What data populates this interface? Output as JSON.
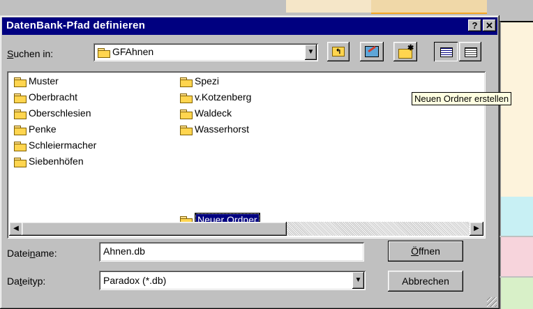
{
  "dialog": {
    "title": "DatenBank-Pfad definieren",
    "help_button": "?",
    "close_button": "✕"
  },
  "lookin": {
    "label_pre": "",
    "label_key": "S",
    "label_post": "uchen in:",
    "value": "GFAhnen"
  },
  "toolbar": {
    "icons": [
      "up-folder-icon",
      "desktop-icon",
      "new-folder-icon",
      "list-view-icon",
      "details-view-icon"
    ]
  },
  "folders_col1": [
    "Muster",
    "Oberbracht",
    "Oberschlesien",
    "Penke",
    "Schleiermacher",
    "Siebenhöfen"
  ],
  "folders_col2": [
    "Spezi",
    "v.Kotzenberg",
    "Waldeck",
    "Wasserhorst"
  ],
  "editing_folder": "Neuer Ordner",
  "tooltip": "Neuen Ordner erstellen",
  "filename": {
    "label_pre": "Datei",
    "label_key": "n",
    "label_post": "ame:",
    "value": "Ahnen.db"
  },
  "filetype": {
    "label_pre": "Da",
    "label_key": "t",
    "label_post": "eityp:",
    "value": "Paradox (*.db)"
  },
  "buttons": {
    "open_pre": "",
    "open_key": "Ö",
    "open_post": "ffnen",
    "cancel": "Abbrechen"
  },
  "colors": {
    "titlebar": "#000080",
    "tooltip_bg": "#ffffe1",
    "folder": "#ffd54f"
  }
}
